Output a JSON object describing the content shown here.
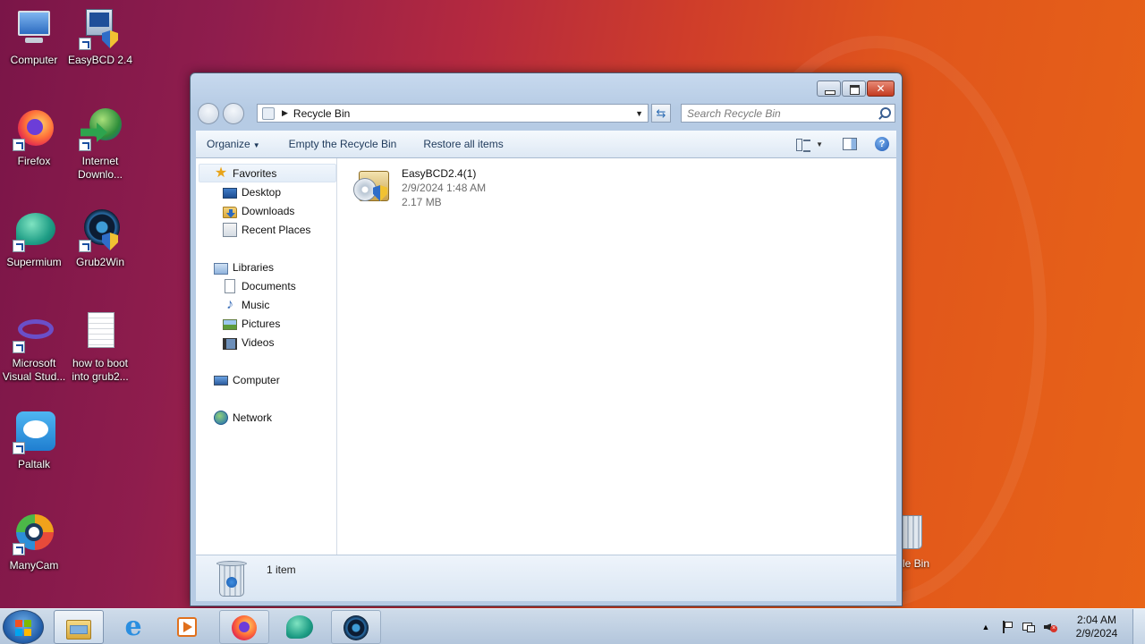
{
  "desktop": {
    "icons": [
      {
        "label": "Computer",
        "icon": "computer-icon"
      },
      {
        "label": "EasyBCD 2.4",
        "icon": "easybcd-icon"
      },
      {
        "label": "Firefox",
        "icon": "firefox-icon"
      },
      {
        "label": "Internet Downlo...",
        "icon": "internet-download-manager-icon"
      },
      {
        "label": "Supermium",
        "icon": "supermium-icon"
      },
      {
        "label": "Grub2Win",
        "icon": "grub2win-icon"
      },
      {
        "label": "Microsoft Visual Stud...",
        "icon": "visual-studio-icon"
      },
      {
        "label": "how to boot into grub2...",
        "icon": "text-file-icon"
      },
      {
        "label": "Paltalk",
        "icon": "paltalk-icon"
      },
      {
        "label": "ManyCam",
        "icon": "manycam-icon"
      }
    ],
    "partial_label": "cle Bin"
  },
  "window": {
    "address": {
      "path": "Recycle Bin"
    },
    "search": {
      "placeholder": "Search Recycle Bin"
    },
    "commands": {
      "organize": "Organize",
      "empty": "Empty the Recycle Bin",
      "restore": "Restore all items"
    },
    "nav": {
      "favorites": "Favorites",
      "desktop": "Desktop",
      "downloads": "Downloads",
      "recent": "Recent Places",
      "libraries": "Libraries",
      "documents": "Documents",
      "music": "Music",
      "pictures": "Pictures",
      "videos": "Videos",
      "computer": "Computer",
      "network": "Network"
    },
    "files": [
      {
        "name": "EasyBCD2.4(1)",
        "date": "2/9/2024 1:48 AM",
        "size": "2.17 MB"
      }
    ],
    "details": {
      "count": "1 item"
    }
  },
  "taskbar": {
    "clock": {
      "time": "2:04 AM",
      "date": "2/9/2024"
    },
    "pinned": [
      "explorer-icon",
      "internet-explorer-icon",
      "media-player-icon",
      "firefox-icon",
      "supermium-icon",
      "grub2win-icon"
    ]
  },
  "colors": {
    "accent": "#1e395b",
    "desktop_left": "#7a1548",
    "desktop_right": "#e86417"
  }
}
